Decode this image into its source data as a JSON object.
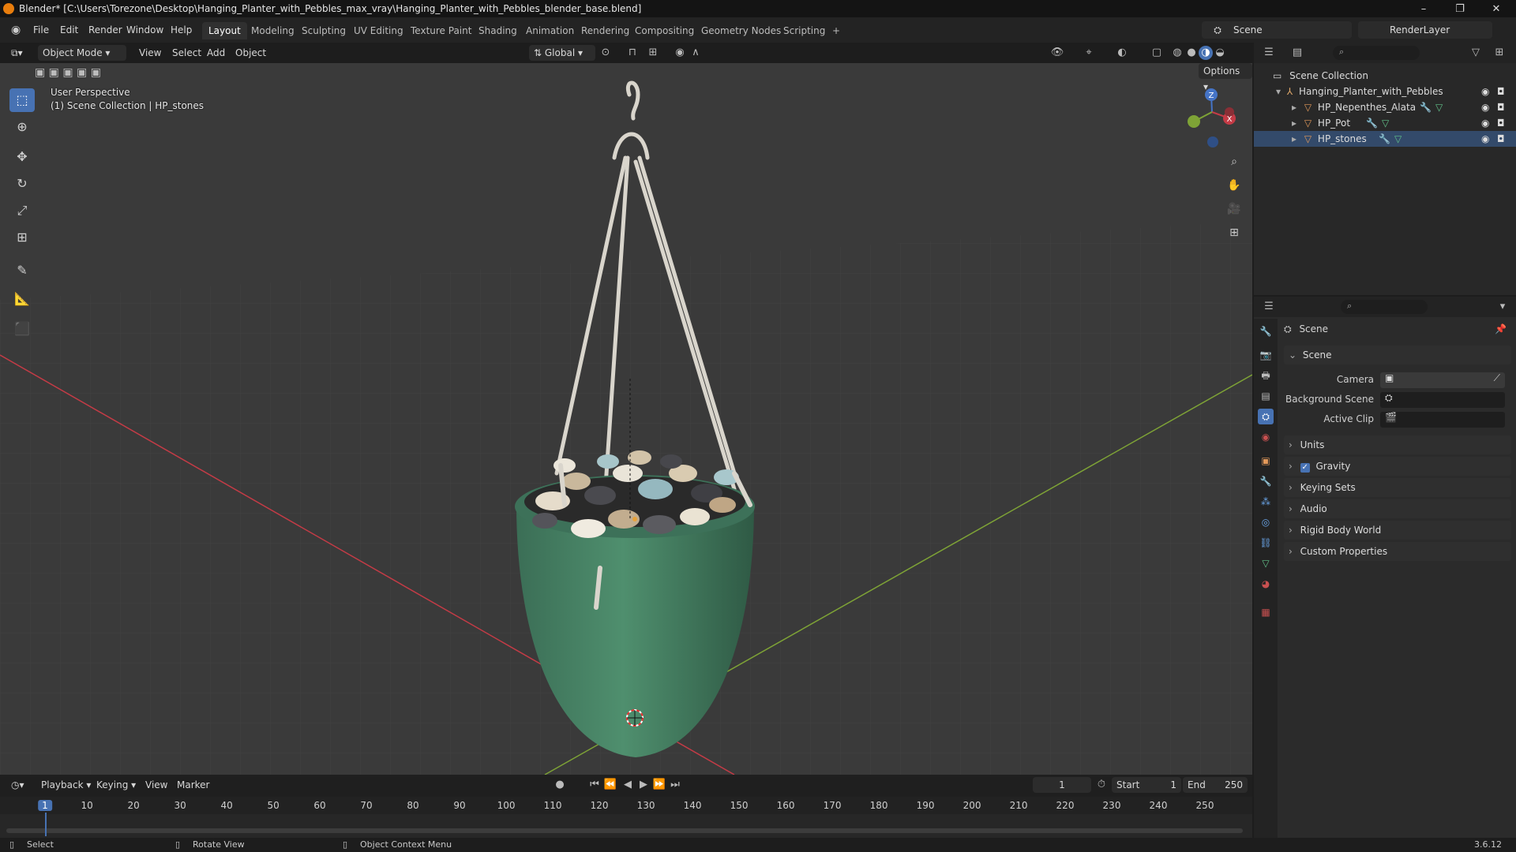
{
  "window": {
    "title": "Blender* [C:\\Users\\Torezone\\Desktop\\Hanging_Planter_with_Pebbles_max_vray\\Hanging_Planter_with_Pebbles_blender_base.blend]",
    "minimize": "–",
    "maximize": "❐",
    "close": "✕"
  },
  "menus": [
    "File",
    "Edit",
    "Render",
    "Window",
    "Help"
  ],
  "workspaces": [
    "Layout",
    "Modeling",
    "Sculpting",
    "UV Editing",
    "Texture Paint",
    "Shading",
    "Animation",
    "Rendering",
    "Compositing",
    "Geometry Nodes",
    "Scripting"
  ],
  "workspace_add": "+",
  "scene_name": "Scene",
  "view_layer": "RenderLayer",
  "viewport_header": {
    "mode": "Object Mode",
    "menus": [
      "View",
      "Select",
      "Add",
      "Object"
    ],
    "orientation": "Global",
    "options": "Options"
  },
  "viewport": {
    "perspective": "User Perspective",
    "collection_info": "(1) Scene Collection | HP_stones",
    "gizmo": {
      "z": "Z",
      "x": "X"
    }
  },
  "outliner": {
    "root": "Scene Collection",
    "collection": "Hanging_Planter_with_Pebbles",
    "objects": [
      "HP_Nepenthes_Alata",
      "HP_Pot",
      "HP_stones"
    ]
  },
  "properties": {
    "context": "Scene",
    "section": "Scene",
    "fields": [
      {
        "label": "Camera"
      },
      {
        "label": "Background Scene"
      },
      {
        "label": "Active Clip"
      }
    ],
    "panels": [
      "Units",
      "Gravity",
      "Keying Sets",
      "Audio",
      "Rigid Body World",
      "Custom Properties"
    ],
    "gravity_checked": true
  },
  "timeline": {
    "menus": [
      "Playback",
      "Keying",
      "View",
      "Marker"
    ],
    "current_frame": "1",
    "start_label": "Start",
    "start": "1",
    "end_label": "End",
    "end": "250",
    "ruler": [
      "1",
      "10",
      "20",
      "30",
      "40",
      "50",
      "60",
      "70",
      "80",
      "90",
      "100",
      "110",
      "120",
      "130",
      "140",
      "150",
      "160",
      "170",
      "180",
      "190",
      "200",
      "210",
      "220",
      "230",
      "240",
      "250"
    ]
  },
  "statusbar": {
    "select": "Select",
    "rotate": "Rotate View",
    "context": "Object Context Menu",
    "version": "3.6.12"
  },
  "colors": {
    "accent": "#4772b3",
    "pot": "#4a8a6a",
    "x_axis": "#c43b46",
    "y_axis": "#7ea336",
    "z_axis": "#4574c7"
  }
}
